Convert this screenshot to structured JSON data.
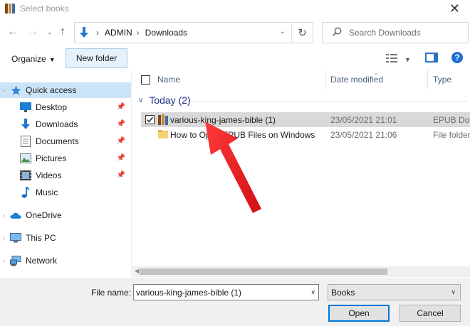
{
  "window": {
    "title": "Select books"
  },
  "nav": {
    "breadcrumb": [
      "ADMIN",
      "Downloads"
    ],
    "search_placeholder": "Search Downloads"
  },
  "toolbar": {
    "organize_label": "Organize",
    "new_folder_label": "New folder"
  },
  "sidebar": {
    "items": [
      {
        "label": "Quick access",
        "icon": "star-icon",
        "selected": true
      },
      {
        "label": "Desktop",
        "icon": "desktop-icon",
        "pinned": true
      },
      {
        "label": "Downloads",
        "icon": "downloads-icon",
        "pinned": true
      },
      {
        "label": "Documents",
        "icon": "documents-icon",
        "pinned": true
      },
      {
        "label": "Pictures",
        "icon": "pictures-icon",
        "pinned": true
      },
      {
        "label": "Videos",
        "icon": "videos-icon",
        "pinned": true
      },
      {
        "label": "Music",
        "icon": "music-icon",
        "pinned": false
      },
      {
        "label": "OneDrive",
        "icon": "cloud-icon"
      },
      {
        "label": "This PC",
        "icon": "computer-icon"
      },
      {
        "label": "Network",
        "icon": "network-icon"
      }
    ]
  },
  "file_list": {
    "columns": {
      "name": "Name",
      "date": "Date modified",
      "type": "Type"
    },
    "group_label": "Today (2)",
    "rows": [
      {
        "name": "various-king-james-bible (1)",
        "date": "23/05/2021 21:01",
        "type": "EPUB Doc",
        "selected": true,
        "icon": "epub-book-icon"
      },
      {
        "name": "How to Open EPUB Files on Windows",
        "date": "23/05/2021 21:06",
        "type": "File folder",
        "selected": false,
        "icon": "folder-icon"
      }
    ]
  },
  "footer": {
    "file_name_label": "File name:",
    "file_name_value": "various-king-james-bible (1)",
    "file_type_value": "Books",
    "open_label": "Open",
    "cancel_label": "Cancel"
  },
  "colors": {
    "accent": "#0078d7",
    "selection": "#cce4f7",
    "arrow": "#e8141c"
  }
}
